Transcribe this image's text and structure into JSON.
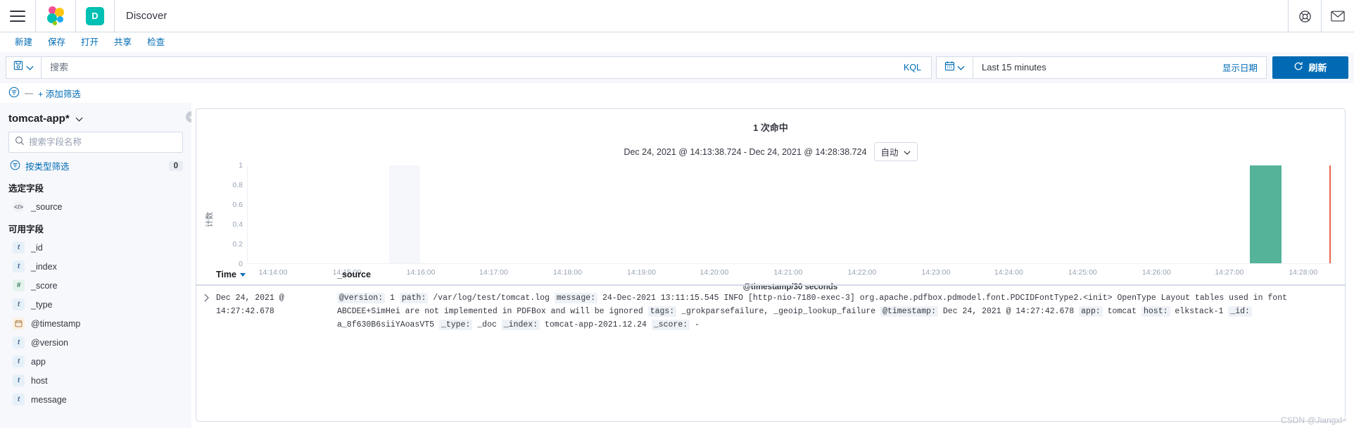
{
  "header": {
    "menu_icon": "hamburger-menu-icon",
    "logo": "elastic-logo",
    "space_badge": "D",
    "app_title": "Discover",
    "right_icons": [
      {
        "name": "help-icon",
        "glyph": "support"
      },
      {
        "name": "mail-icon",
        "glyph": "envelope"
      }
    ]
  },
  "menubar": {
    "items": [
      {
        "label": "新建"
      },
      {
        "label": "保存"
      },
      {
        "label": "打开"
      },
      {
        "label": "共享"
      },
      {
        "label": "检查"
      }
    ]
  },
  "querybar": {
    "saved_query_icon": "save-icon",
    "search_placeholder": "搜索",
    "search_value": "",
    "language_label": "KQL",
    "calendar_icon": "calendar-icon",
    "time_range": "Last 15 minutes",
    "show_dates_label": "显示日期",
    "refresh_label": "刷新",
    "refresh_icon": "refresh-icon"
  },
  "filterbar": {
    "filter_icon": "filter-icon",
    "dash": "—",
    "add_filter_label": "+ 添加筛选"
  },
  "sidebar": {
    "index_pattern": "tomcat-app*",
    "field_search_placeholder": "搜索字段名称",
    "filter_by_type_label": "按类型筛选",
    "filter_by_type_count": "0",
    "selected_fields_title": "选定字段",
    "selected_fields": [
      {
        "name": "_source",
        "type": "source",
        "glyph": "</>"
      }
    ],
    "available_fields_title": "可用字段",
    "available_fields": [
      {
        "name": "_id",
        "type": "string",
        "glyph": "t"
      },
      {
        "name": "_index",
        "type": "string",
        "glyph": "t"
      },
      {
        "name": "_score",
        "type": "number",
        "glyph": "#"
      },
      {
        "name": "_type",
        "type": "string",
        "glyph": "t"
      },
      {
        "name": "@timestamp",
        "type": "date",
        "glyph": "▦"
      },
      {
        "name": "@version",
        "type": "string",
        "glyph": "t"
      },
      {
        "name": "app",
        "type": "string",
        "glyph": "t"
      },
      {
        "name": "host",
        "type": "string",
        "glyph": "t"
      },
      {
        "name": "message",
        "type": "string",
        "glyph": "t"
      }
    ],
    "collapse_icon": "collapse-sidebar-icon"
  },
  "chart_data": {
    "type": "bar",
    "title": "1 次命中",
    "subtitle": "Dec 24, 2021 @ 14:13:38.724 - Dec 24, 2021 @ 14:28:38.724",
    "interval_label": "自动",
    "xlabel": "@timestamp/30 seconds",
    "ylabel": "计数",
    "ylim": [
      0,
      1
    ],
    "y_ticks": [
      "0",
      "0.2",
      "0.4",
      "0.6",
      "0.8",
      "1"
    ],
    "x_ticks": [
      "14:14:00",
      "14:15:00",
      "14:16:00",
      "14:17:00",
      "14:18:00",
      "14:19:00",
      "14:20:00",
      "14:21:00",
      "14:22:00",
      "14:23:00",
      "14:24:00",
      "14:25:00",
      "14:26:00",
      "14:27:00",
      "14:28:00"
    ],
    "categories": [
      "14:27:30"
    ],
    "values": [
      1
    ],
    "bar_color": "#54B399",
    "end_marker_color": "#E7664C",
    "grid": false,
    "legend": "none"
  },
  "table": {
    "columns": [
      {
        "label": "Time",
        "sorted": true
      },
      {
        "label": "_source",
        "sorted": false
      }
    ],
    "rows": [
      {
        "expand_icon": "chevron-right-icon",
        "time": "Dec 24, 2021 @ 14:27:42.678",
        "fields": [
          {
            "key": "@version:",
            "value": "1"
          },
          {
            "key": "path:",
            "value": "/var/log/test/tomcat.log"
          },
          {
            "key": "message:",
            "value": "24-Dec-2021 13:11:15.545 INFO [http-nio-7180-exec-3] org.apache.pdfbox.pdmodel.font.PDCIDFontType2.<init> OpenType Layout tables used in font ABCDEE+SimHei are not implemented in PDFBox and will be ignored"
          },
          {
            "key": "tags:",
            "value": "_grokparsefailure, _geoip_lookup_failure"
          },
          {
            "key": "@timestamp:",
            "value": "Dec 24, 2021 @ 14:27:42.678"
          },
          {
            "key": "app:",
            "value": "tomcat"
          },
          {
            "key": "host:",
            "value": "elkstack-1"
          },
          {
            "key": "_id:",
            "value": "a_8f630B6siiYAoasVT5"
          },
          {
            "key": "_type:",
            "value": "_doc"
          },
          {
            "key": "_index:",
            "value": "tomcat-app-2021.12.24"
          },
          {
            "key": "_score:",
            "value": "-"
          }
        ]
      }
    ]
  },
  "watermark": "CSDN @Jiangxl~"
}
